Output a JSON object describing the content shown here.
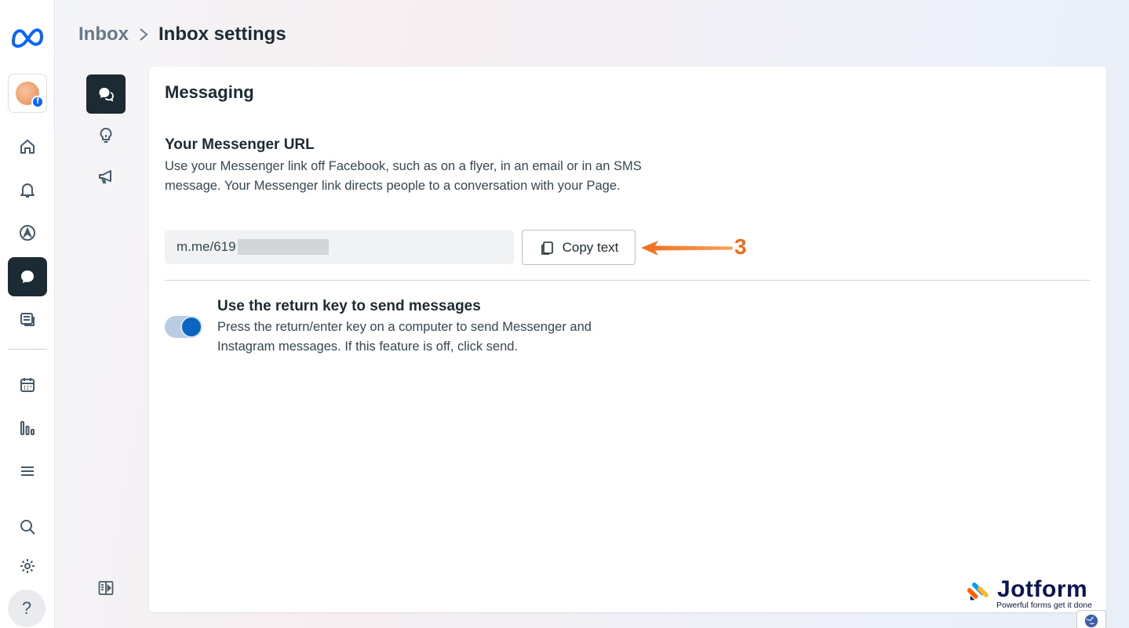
{
  "breadcrumb": {
    "parent": "Inbox",
    "current": "Inbox settings"
  },
  "rail": {
    "items": [
      "meta-logo-icon",
      "page-avatar",
      "home-icon",
      "bell-icon",
      "compass-icon",
      "messenger-icon",
      "content-icon",
      "calendar-icon",
      "insights-icon",
      "menu-icon",
      "search-icon",
      "gear-icon",
      "help-icon"
    ],
    "help_label": "?"
  },
  "subrail": {
    "items": [
      "chat-bubbles-icon",
      "lightbulb-icon",
      "megaphone-icon",
      "panel-toggle-icon"
    ]
  },
  "card": {
    "title": "Messaging",
    "messenger_url": {
      "title": "Your Messenger URL",
      "description": "Use your Messenger link off Facebook, such as on a flyer, in an email or in an SMS message. Your Messenger link directs people to a conversation with your Page.",
      "value": "m.me/619",
      "copy_label": "Copy text"
    },
    "return_key": {
      "title": "Use the return key to send messages",
      "description": "Press the return/enter key on a computer to send Messenger and Instagram messages. If this feature is off, click send.",
      "enabled": true
    }
  },
  "annotation": {
    "number": "3",
    "color": "#ef6c1b"
  },
  "watermark": {
    "name": "Jotform",
    "tagline": "Powerful forms get it done"
  },
  "colors": {
    "accent": "#0a66c2",
    "nav_active": "#1c2b33",
    "meta_blue": "#0866ff"
  }
}
